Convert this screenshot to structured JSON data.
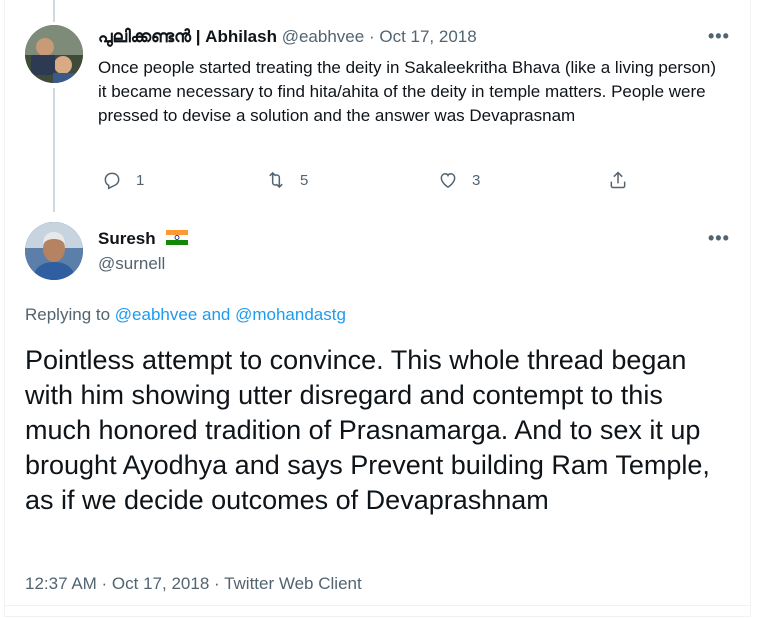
{
  "parent_tweet": {
    "display_name": "പുലിക്കണ്ടൻ | Abhilash",
    "handle": "@eabhvee",
    "separator": "·",
    "date": "Oct 17, 2018",
    "text": "Once people started treating the deity in Sakaleekritha Bhava (like a living person) it became necessary to find hita/ahita of the deity in temple matters. People were pressed to devise a solution and the answer was Devaprasnam",
    "more": "•••",
    "replies": "1",
    "retweets": "5",
    "likes": "3"
  },
  "main_tweet": {
    "display_name": "Suresh",
    "handle": "@surnell",
    "more": "•••",
    "replying_prefix": "Replying to",
    "replying_users": "@eabhvee and @mohandastg",
    "text": "Pointless attempt to convince. This whole thread began with him showing utter disregard and contempt to this much honored tradition of Prasnamarga. And to sex it up brought Ayodhya and says Prevent building Ram Temple, as if we decide outcomes of Devaprashnam",
    "meta": "12:37 AM · Oct 17, 2018 · Twitter Web Client"
  },
  "icons": {
    "reply": "reply-icon",
    "retweet": "retweet-icon",
    "like": "like-icon",
    "share": "share-icon",
    "flag": "india-flag-icon"
  },
  "colors": {
    "link": "#1d9bf0",
    "muted": "#536471",
    "text": "#0f1419"
  }
}
